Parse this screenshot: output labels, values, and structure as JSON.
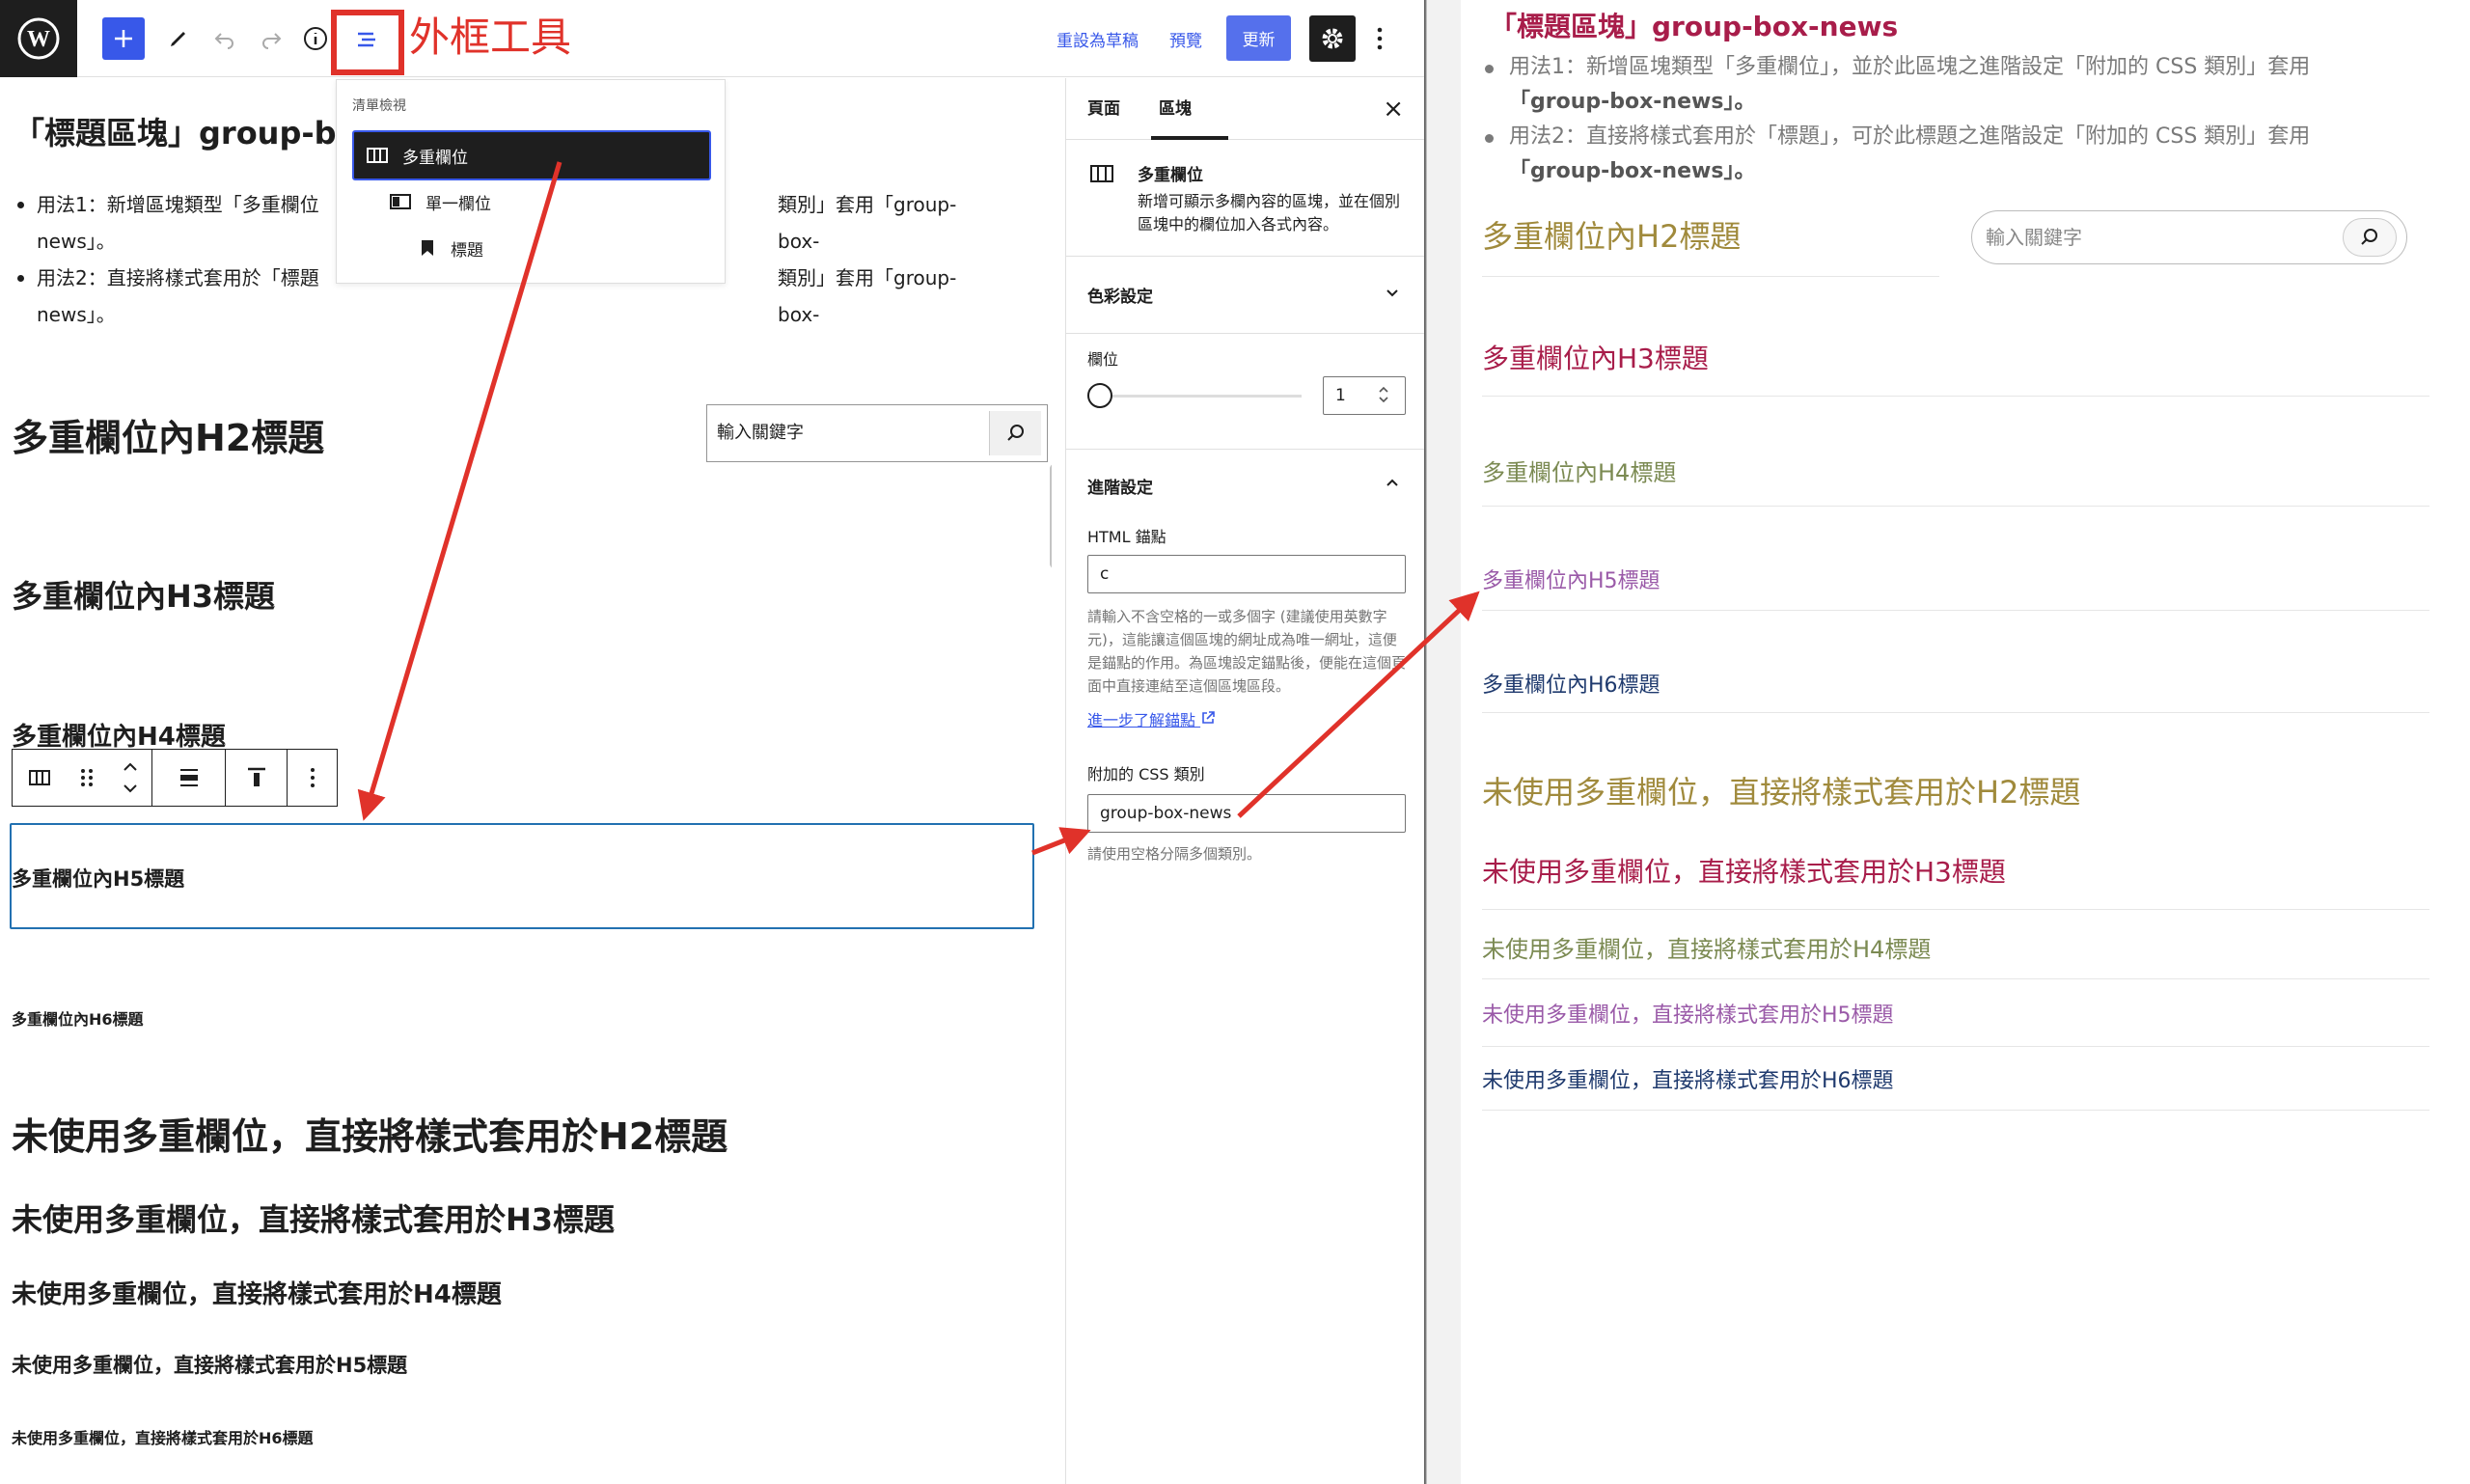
{
  "annotation": {
    "title": "外框工具"
  },
  "toolbar": {
    "save_draft": "重設為草稿",
    "preview": "預覽",
    "update": "更新"
  },
  "canvas": {
    "title": "「標題區塊」group-bo",
    "usage1": "用法1：新增區塊類型「多重欄位」，並於此區塊之進階設定「附加的 CSS 類別」套用「group-box-news」。",
    "usage1_visible_left": "用法1：新增區塊類型「多重欄位",
    "usage1_visible_right": "類別」套用「group-box-",
    "usage1_tail": "news」。",
    "usage2_visible_left": "用法2：直接將樣式套用於「標題",
    "usage2_visible_right": "類別」套用「group-box-",
    "usage2_tail": "news」。",
    "h2": "多重欄位內H2標題",
    "h3": "多重欄位內H3標題",
    "h4": "多重欄位內H4標題",
    "h5": "多重欄位內H5標題",
    "h6": "多重欄位內H6標題",
    "search_placeholder": "輸入關鍵字",
    "plain_h2": "未使用多重欄位，直接將樣式套用於H2標題",
    "plain_h3": "未使用多重欄位，直接將樣式套用於H3標題",
    "plain_h4": "未使用多重欄位，直接將樣式套用於H4標題",
    "plain_h5": "未使用多重欄位，直接將樣式套用於H5標題",
    "plain_h6": "未使用多重欄位，直接將樣式套用於H6標題"
  },
  "list_view": {
    "heading": "清單檢視",
    "items": [
      {
        "label": "多重欄位",
        "icon": "columns-icon"
      },
      {
        "label": "單一欄位",
        "icon": "column-icon"
      },
      {
        "label": "標題",
        "icon": "bookmark-icon"
      }
    ]
  },
  "sidebar": {
    "tab_page": "頁面",
    "tab_block": "區塊",
    "block_name": "多重欄位",
    "block_desc": "新增可顯示多欄內容的區塊，並在個別區塊中的欄位加入各式內容。",
    "color_settings": "色彩設定",
    "columns_label": "欄位",
    "columns_value": "1",
    "advanced": "進階設定",
    "anchor_label": "HTML 錨點",
    "anchor_value": "c",
    "anchor_help": "請輸入不含空格的一或多個字 (建議使用英數字元)，這能讓這個區塊的網址成為唯一網址，這便是錨點的作用。為區塊設定錨點後，便能在這個頁面中直接連結至這個區塊區段。",
    "anchor_link": "進一步了解錨點",
    "css_label": "附加的 CSS 類別",
    "css_value": "group-box-news",
    "css_help": "請使用空格分隔多個類別。"
  },
  "preview": {
    "title": "「標題區塊」group-box-news",
    "usage1_a": "用法1：新增區塊類型「多重欄位」，並於此區塊之進階設定「附加的 CSS 類別」套用",
    "usage1_b": "「group-box-news」。",
    "usage2_a": "用法2：直接將樣式套用於「標題」，可於此標題之進階設定「附加的 CSS 類別」套用",
    "usage2_b": "「group-box-news」。",
    "h2": "多重欄位內H2標題",
    "h3": "多重欄位內H3標題",
    "h4": "多重欄位內H4標題",
    "h5": "多重欄位內H5標題",
    "h6": "多重欄位內H6標題",
    "search_placeholder": "輸入關鍵字",
    "plain_h2": "未使用多重欄位，直接將樣式套用於H2標題",
    "plain_h3": "未使用多重欄位，直接將樣式套用於H3標題",
    "plain_h4": "未使用多重欄位，直接將樣式套用於H4標題",
    "plain_h5": "未使用多重欄位，直接將樣式套用於H5標題",
    "plain_h6": "未使用多重欄位，直接將樣式套用於H6標題"
  },
  "colors": {
    "accent": "#3858e9",
    "annotation": "#e0322a",
    "h2": "#a08a3c",
    "h3": "#a81d4a",
    "h4": "#7b8a52",
    "h5": "#9a5aa8",
    "h6": "#1f3a6e"
  }
}
